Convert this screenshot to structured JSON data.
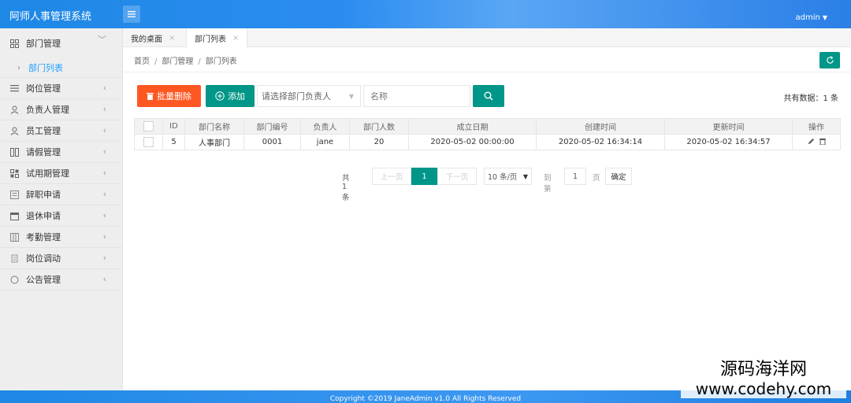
{
  "header": {
    "brand": "阿师人事管理系统",
    "user": "admin"
  },
  "sidebar": {
    "items": [
      {
        "label": "部门管理",
        "icon": "grid-icon",
        "open": true,
        "children": [
          {
            "label": "部门列表"
          }
        ]
      },
      {
        "label": "岗位管理",
        "icon": "list-icon"
      },
      {
        "label": "负责人管理",
        "icon": "user-icon"
      },
      {
        "label": "员工管理",
        "icon": "user-icon"
      },
      {
        "label": "请假管理",
        "icon": "columns-icon"
      },
      {
        "label": "试用期管理",
        "icon": "apps-icon"
      },
      {
        "label": "辞职申请",
        "icon": "form-icon"
      },
      {
        "label": "退休申请",
        "icon": "calendar-icon"
      },
      {
        "label": "考勤管理",
        "icon": "table-icon"
      },
      {
        "label": "岗位调动",
        "icon": "template-icon"
      },
      {
        "label": "公告管理",
        "icon": "circle-icon"
      }
    ]
  },
  "tabs": [
    {
      "label": "我的桌面"
    },
    {
      "label": "部门列表"
    }
  ],
  "breadcrumb": {
    "home": "首页",
    "parent": "部门管理",
    "current": "部门列表"
  },
  "toolbar": {
    "batch_delete": "批量删除",
    "add": "添加",
    "manager_select": "请选择部门负责人",
    "name_placeholder": "名称",
    "total": "共有数据：1 条"
  },
  "table": {
    "columns": [
      "ID",
      "部门名称",
      "部门编号",
      "负责人",
      "部门人数",
      "成立日期",
      "创建时间",
      "更新时间",
      "操作"
    ],
    "rows": [
      {
        "id": "5",
        "name": "人事部门",
        "code": "0001",
        "manager": "jane",
        "count": "20",
        "founded": "2020-05-02 00:00:00",
        "created": "2020-05-02 16:34:14",
        "updated": "2020-05-02 16:34:57"
      }
    ]
  },
  "pagination": {
    "count": "共 1 条",
    "prev": "上一页",
    "current": "1",
    "next": "下一页",
    "page_size": "10 条/页",
    "goto_label": "到第",
    "goto_value": "1",
    "page_unit": "页",
    "confirm": "确定"
  },
  "footer": {
    "copyright": "Copyright ©2019 JaneAdmin v1.0 All Rights Reserved"
  },
  "watermark": {
    "line1": "源码海洋网",
    "line2": "www.codehy.com"
  },
  "colors": {
    "primary": "#009688",
    "danger": "#FF5722",
    "header": "#1E88E5",
    "link": "#1E9FFF"
  }
}
